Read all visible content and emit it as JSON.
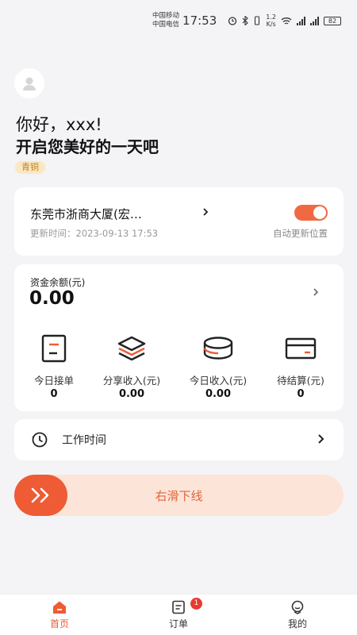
{
  "status_bar": {
    "carrier_1": "中国移动",
    "carrier_2": "中国电信",
    "time": "17:53",
    "speed_value": "1.2",
    "speed_unit": "K/s",
    "battery": "82"
  },
  "header": {
    "greeting": "你好，xxx!",
    "subtitle": "开启您美好的一天吧",
    "level": "青铜"
  },
  "location": {
    "name": "东莞市浙商大厦(宏…",
    "updated": "更新时间：2023-09-13 17:53",
    "auto_update_label": "自动更新位置",
    "auto_update_on": true
  },
  "funds": {
    "label": "资金余额(元)",
    "value": "0.00",
    "stats": [
      {
        "label": "今日接单",
        "value": "0",
        "icon": "order-icon"
      },
      {
        "label": "分享收入(元)",
        "value": "0.00",
        "icon": "layers-icon"
      },
      {
        "label": "今日收入(元)",
        "value": "0.00",
        "icon": "coins-icon"
      },
      {
        "label": "待结算(元)",
        "value": "0",
        "icon": "card-icon"
      }
    ]
  },
  "work_time": {
    "label": "工作时间",
    "icon": "clock-icon"
  },
  "slider": {
    "label": "右滑下线"
  },
  "tabbar": {
    "items": [
      {
        "label": "首页",
        "icon": "home-icon",
        "active": true
      },
      {
        "label": "订单",
        "icon": "order-list-icon",
        "badge": "1"
      },
      {
        "label": "我的",
        "icon": "profile-icon"
      }
    ]
  },
  "colors": {
    "accent": "#ee5b35",
    "slider_bg": "#fce5d8",
    "badge": "#e83a30"
  }
}
